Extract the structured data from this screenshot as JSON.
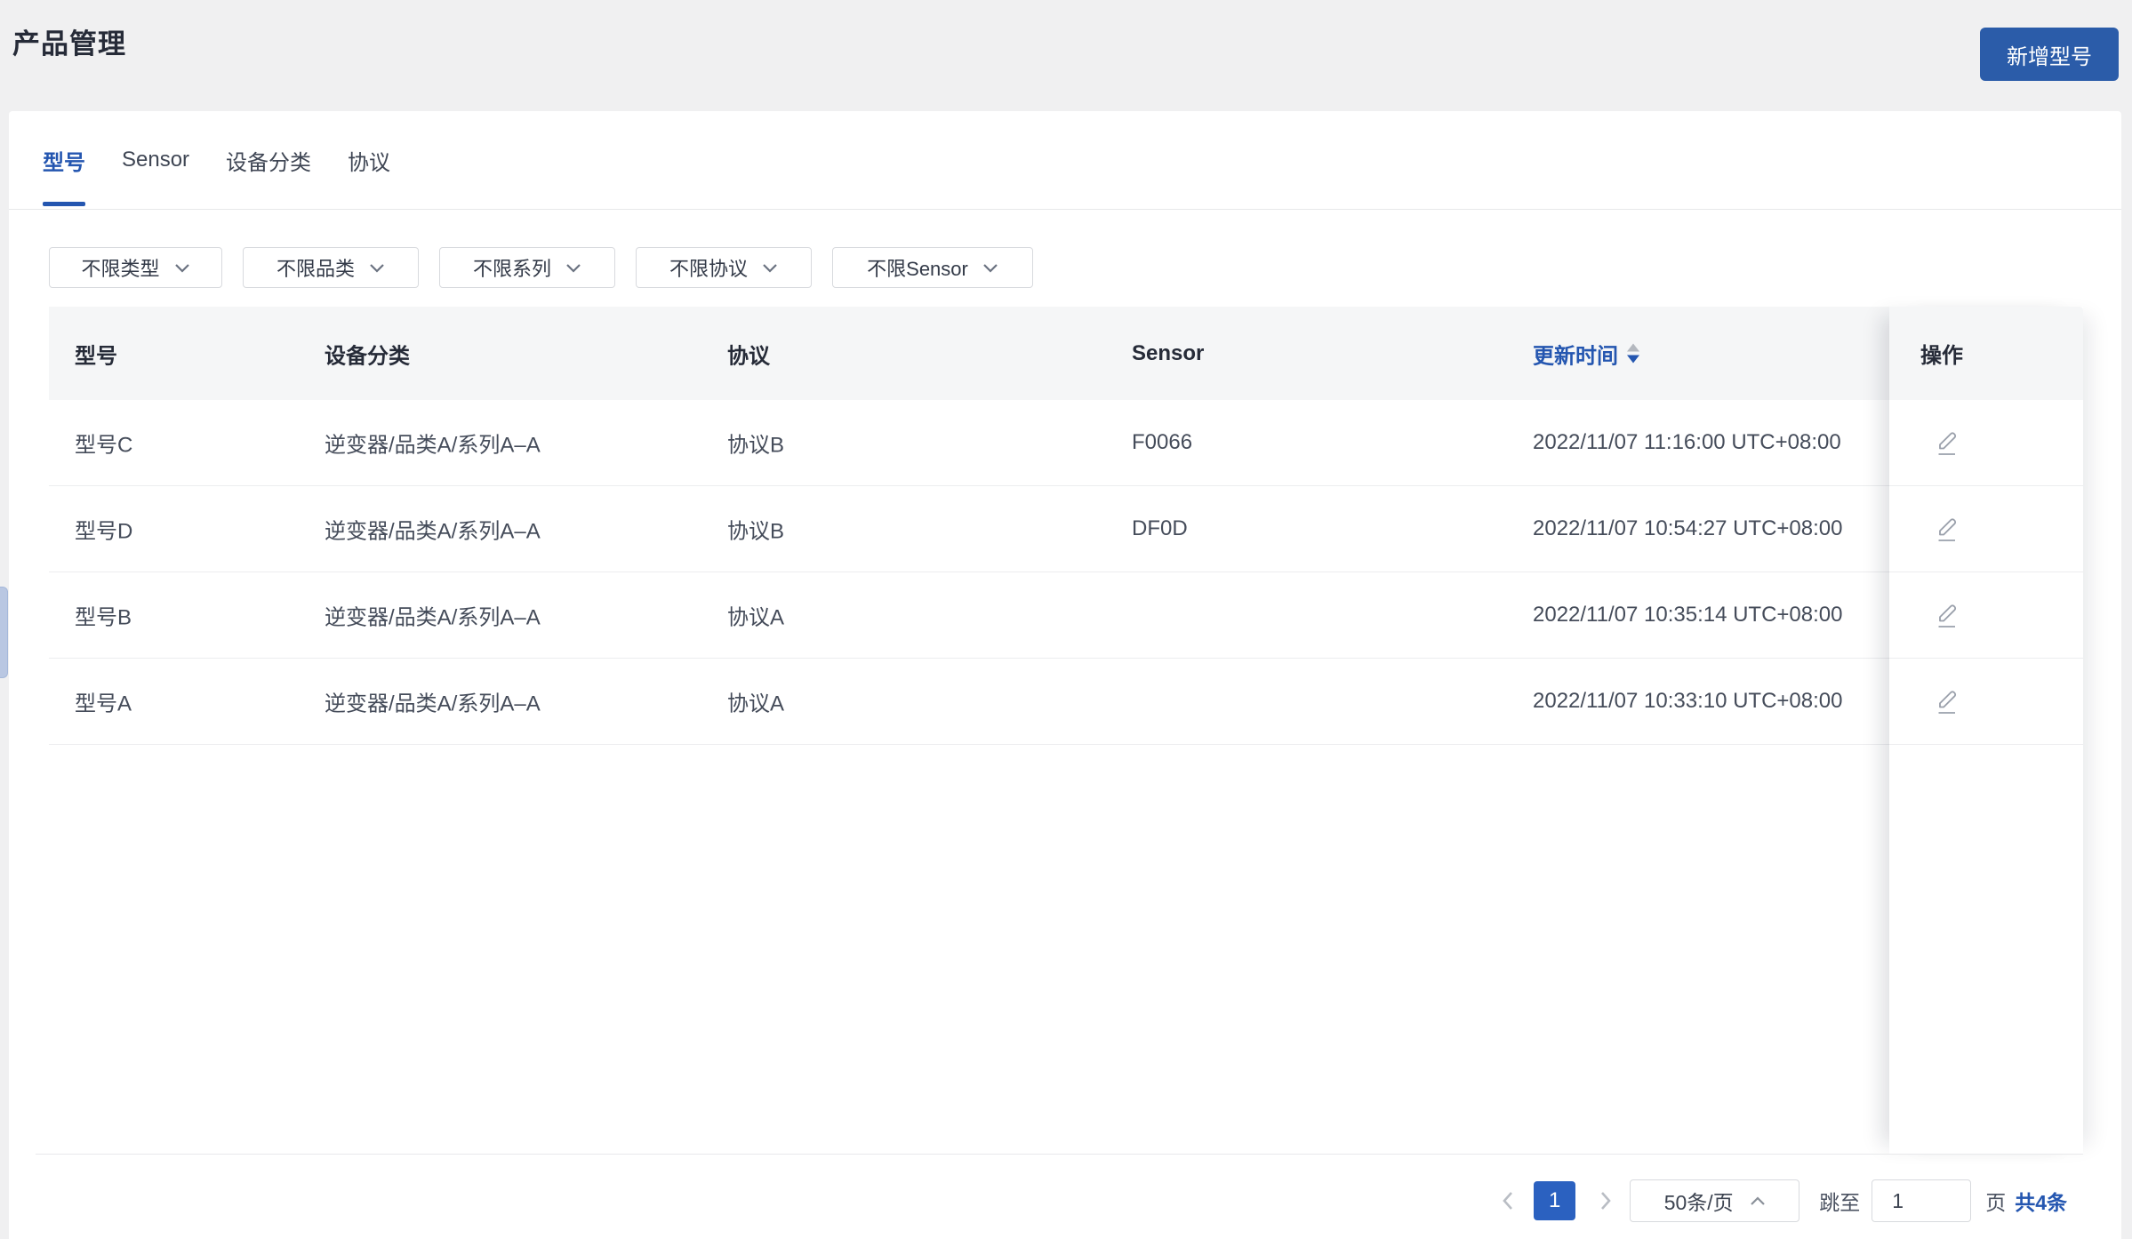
{
  "page": {
    "title": "产品管理"
  },
  "toolbar": {
    "add_button_label": "新增型号"
  },
  "tabs": [
    {
      "label": "型号",
      "active": true
    },
    {
      "label": "Sensor",
      "active": false
    },
    {
      "label": "设备分类",
      "active": false
    },
    {
      "label": "协议",
      "active": false
    }
  ],
  "filters": [
    {
      "label": "不限类型",
      "icon": "chevron-down-icon"
    },
    {
      "label": "不限品类",
      "icon": "chevron-down-icon"
    },
    {
      "label": "不限系列",
      "icon": "chevron-down-icon"
    },
    {
      "label": "不限协议",
      "icon": "chevron-down-icon"
    },
    {
      "label": "不限Sensor",
      "icon": "chevron-down-icon"
    }
  ],
  "table": {
    "columns": [
      "型号",
      "设备分类",
      "协议",
      "Sensor",
      "更新时间",
      "操作"
    ],
    "sort": {
      "column": "更新时间",
      "direction": "desc"
    },
    "rows": [
      {
        "model": "型号C",
        "category": "逆变器/品类A/系列A–A",
        "protocol": "协议B",
        "sensor": "F0066",
        "updated": "2022/11/07 11:16:00 UTC+08:00",
        "action_icon": "edit-pencil-icon"
      },
      {
        "model": "型号D",
        "category": "逆变器/品类A/系列A–A",
        "protocol": "协议B",
        "sensor": "DF0D",
        "updated": "2022/11/07 10:54:27 UTC+08:00",
        "action_icon": "edit-pencil-icon"
      },
      {
        "model": "型号B",
        "category": "逆变器/品类A/系列A–A",
        "protocol": "协议A",
        "sensor": "",
        "updated": "2022/11/07 10:35:14 UTC+08:00",
        "action_icon": "edit-pencil-icon"
      },
      {
        "model": "型号A",
        "category": "逆变器/品类A/系列A–A",
        "protocol": "协议A",
        "sensor": "",
        "updated": "2022/11/07 10:33:10 UTC+08:00",
        "action_icon": "edit-pencil-icon"
      }
    ]
  },
  "pagination": {
    "prev_icon": "chevron-left-icon",
    "current_page": "1",
    "next_icon": "chevron-right-icon",
    "page_size": "50条/页",
    "page_size_icon": "chevron-up-icon",
    "jump_label": "跳至",
    "jump_value": "1",
    "page_unit": "页",
    "total": "共4条"
  },
  "colors": {
    "accent": "#2456b0",
    "btn-blue": "#2b5ca9",
    "page-btn-blue": "#2b61c0",
    "page-bg": "#f0f0f1"
  }
}
